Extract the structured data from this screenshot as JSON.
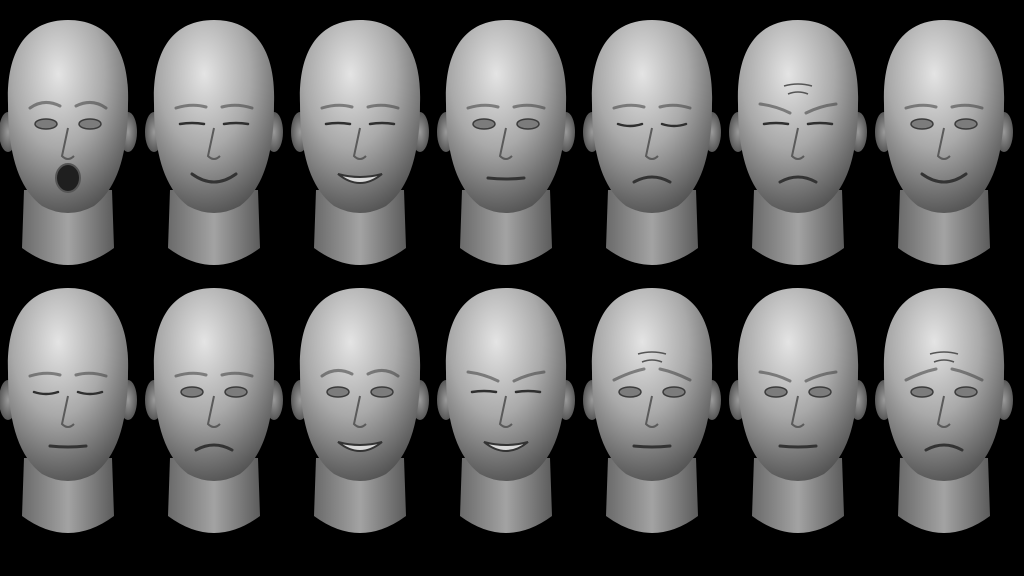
{
  "scene": {
    "background_color": "#000000",
    "skin_tone": "#a9a9a9",
    "highlight_color": "#e4e4e4",
    "shadow_color": "#2b2b2b",
    "rows": [
      {
        "name": "top-row",
        "heads": [
          {
            "expression": "surprised-open-mouth",
            "brow": "raised",
            "eyes": "open",
            "mouth": "open"
          },
          {
            "expression": "smile",
            "brow": "neutral",
            "eyes": "squint",
            "mouth": "smile"
          },
          {
            "expression": "grin",
            "brow": "neutral",
            "eyes": "squint",
            "mouth": "grin"
          },
          {
            "expression": "neutral",
            "brow": "neutral",
            "eyes": "open",
            "mouth": "neutral"
          },
          {
            "expression": "pout-eyes-closed",
            "brow": "neutral",
            "eyes": "closed",
            "mouth": "pout"
          },
          {
            "expression": "scrunched-disgust",
            "brow": "scrunch",
            "eyes": "squint",
            "mouth": "pout"
          },
          {
            "expression": "smirk",
            "brow": "neutral",
            "eyes": "open",
            "mouth": "smile"
          }
        ]
      },
      {
        "name": "bottom-row",
        "heads": [
          {
            "expression": "relaxed-eyes-closed",
            "brow": "neutral",
            "eyes": "closed",
            "mouth": "neutral"
          },
          {
            "expression": "doubtful-frown",
            "brow": "neutral",
            "eyes": "open",
            "mouth": "frown"
          },
          {
            "expression": "bared-teeth-grin",
            "brow": "raised",
            "eyes": "open",
            "mouth": "teeth"
          },
          {
            "expression": "grimace",
            "brow": "furrowed",
            "eyes": "squint",
            "mouth": "teeth"
          },
          {
            "expression": "worried",
            "brow": "worried",
            "eyes": "open",
            "mouth": "neutral"
          },
          {
            "expression": "stern",
            "brow": "furrowed",
            "eyes": "open",
            "mouth": "neutral"
          },
          {
            "expression": "sad-frown",
            "brow": "worried",
            "eyes": "open",
            "mouth": "frown"
          }
        ]
      }
    ]
  }
}
